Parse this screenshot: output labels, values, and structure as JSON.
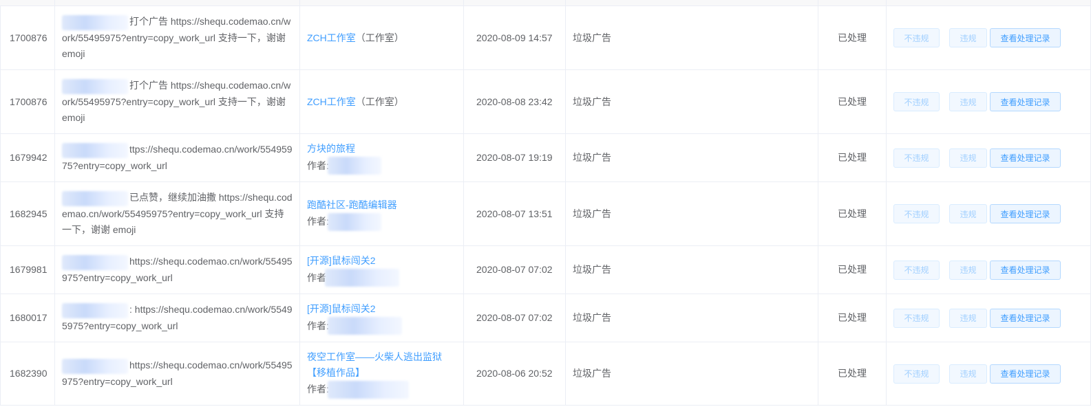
{
  "rows": [
    {
      "id": "1700876",
      "content": "打个广告 https://shequ.codemao.cn/work/55495975?entry=copy_work_url 支持一下，谢谢 emoji",
      "work_title": "ZCH工作室",
      "work_type": "（工作室）",
      "author_label": "",
      "time": "2020-08-09 14:57",
      "reason": "垃圾广告",
      "status": "已处理"
    },
    {
      "id": "1700876",
      "content": "打个广告 https://shequ.codemao.cn/work/55495975?entry=copy_work_url 支持一下，谢谢 emoji",
      "work_title": "ZCH工作室",
      "work_type": "（工作室）",
      "author_label": "",
      "time": "2020-08-08 23:42",
      "reason": "垃圾广告",
      "status": "已处理"
    },
    {
      "id": "1679942",
      "content": "ttps://shequ.codemao.cn/work/55495975?entry=copy_work_url",
      "work_title": "方块的旅程",
      "work_type": "",
      "author_label": "作者:",
      "time": "2020-08-07 19:19",
      "reason": "垃圾广告",
      "status": "已处理"
    },
    {
      "id": "1682945",
      "content": "已点赞，继续加油撒 https://shequ.codemao.cn/work/55495975?entry=copy_work_url 支持一下，谢谢 emoji",
      "work_title": "跑酷社区-跑酷编辑器",
      "work_type": "",
      "author_label": "作者:",
      "time": "2020-08-07 13:51",
      "reason": "垃圾广告",
      "status": "已处理"
    },
    {
      "id": "1679981",
      "content": "https://shequ.codemao.cn/work/55495975?entry=copy_work_url",
      "work_title": "[开源]鼠标闯关2",
      "work_type": "",
      "author_label": "作者",
      "time": "2020-08-07 07:02",
      "reason": "垃圾广告",
      "status": "已处理"
    },
    {
      "id": "1680017",
      "content": ": https://shequ.codemao.cn/work/55495975?entry=copy_work_url",
      "work_title": "[开源]鼠标闯关2",
      "work_type": "",
      "author_label": "作者:",
      "time": "2020-08-07 07:02",
      "reason": "垃圾广告",
      "status": "已处理"
    },
    {
      "id": "1682390",
      "content": "https://shequ.codemao.cn/work/55495975?entry=copy_work_url",
      "work_title": "夜空工作室——火柴人逃出监狱【移植作品】",
      "work_type": "",
      "author_label": "作者:",
      "time": "2020-08-06 20:52",
      "reason": "垃圾广告",
      "status": "已处理"
    }
  ],
  "actions": {
    "not_violate": "不违规",
    "violate": "违规",
    "view_record": "查看处理记录"
  },
  "colors": {
    "link": "#409eff",
    "border": "#ebeef5",
    "text": "#606266",
    "button_bg": "#ecf5ff"
  }
}
